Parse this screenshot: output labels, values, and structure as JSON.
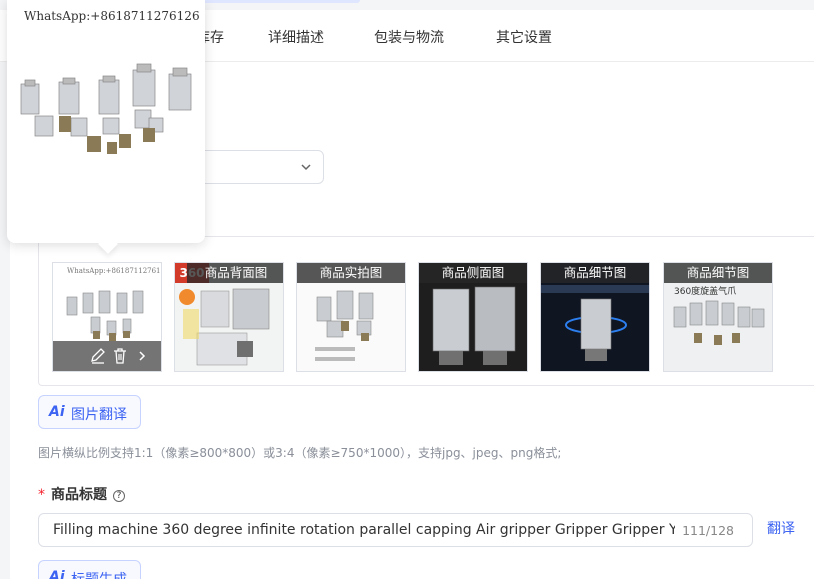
{
  "tabs": [
    {
      "label": "库存"
    },
    {
      "label": "详细描述"
    },
    {
      "label": "包装与物流"
    },
    {
      "label": "其它设置"
    }
  ],
  "popover": {
    "watermark": "WhatsApp:+8618711276126"
  },
  "images": [
    {
      "caption": "",
      "watermark": "WhatsApp:+8618711276126",
      "actions": [
        "edit-icon",
        "trash-icon",
        "chevron-right-icon"
      ]
    },
    {
      "caption": "商品背面图",
      "badge": "360"
    },
    {
      "caption": "商品实拍图"
    },
    {
      "caption": "商品侧面图"
    },
    {
      "caption": "商品细节图"
    },
    {
      "caption": "商品细节图",
      "subtext": "360度旋盖气爪"
    }
  ],
  "image_translate_button": {
    "icon": "Ai",
    "label": "图片翻译"
  },
  "image_hint": "图片横纵比例支持1:1（像素≥800*800）或3:4（像素≥750*1000），支持jpg、jpeg、png格式;",
  "product_title": {
    "required_mark": "*",
    "label": "商品标题",
    "help_icon": "?",
    "value": "Filling machine 360 degree infinite rotation parallel capping Air gripper Gripper Gripper YCM",
    "count": "111/128",
    "translate_link": "翻译"
  },
  "title_generate_button": {
    "icon": "Ai",
    "label": "标题生成"
  },
  "colors": {
    "accent": "#3c63f2",
    "required": "#f5222d",
    "hint": "#8a8f99"
  }
}
